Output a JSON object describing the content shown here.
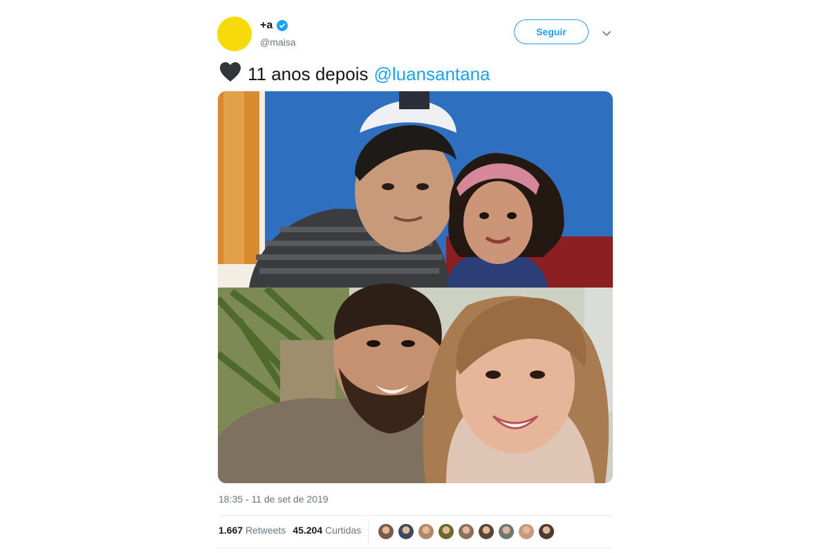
{
  "tweet": {
    "author": {
      "display_name": "+a",
      "handle": "@maisa",
      "avatar_color": "#f7da0a",
      "verified": true
    },
    "follow_label": "Seguir",
    "text": {
      "emoji": "black-heart-icon",
      "body": "11 anos depois",
      "mention": "@luansantana"
    },
    "media": {
      "top_photo_icon": "photo-2008",
      "bottom_photo_icon": "photo-2019"
    },
    "timestamp": "18:35 - 11 de set de 2019",
    "stats": {
      "retweets_count": "1.667",
      "retweets_label": "Retweets",
      "likes_count": "45.204",
      "likes_label": "Curtidas"
    },
    "liker_avatar_colors": [
      "#7a5a4a",
      "#3d4a5c",
      "#b08868",
      "#6b6a2e",
      "#8a6f5c",
      "#5a4636",
      "#6e7a70",
      "#c49a7a",
      "#4e3a30"
    ]
  },
  "colors": {
    "accent": "#1da1f2",
    "text_primary": "#14171a",
    "text_secondary": "#657786"
  }
}
